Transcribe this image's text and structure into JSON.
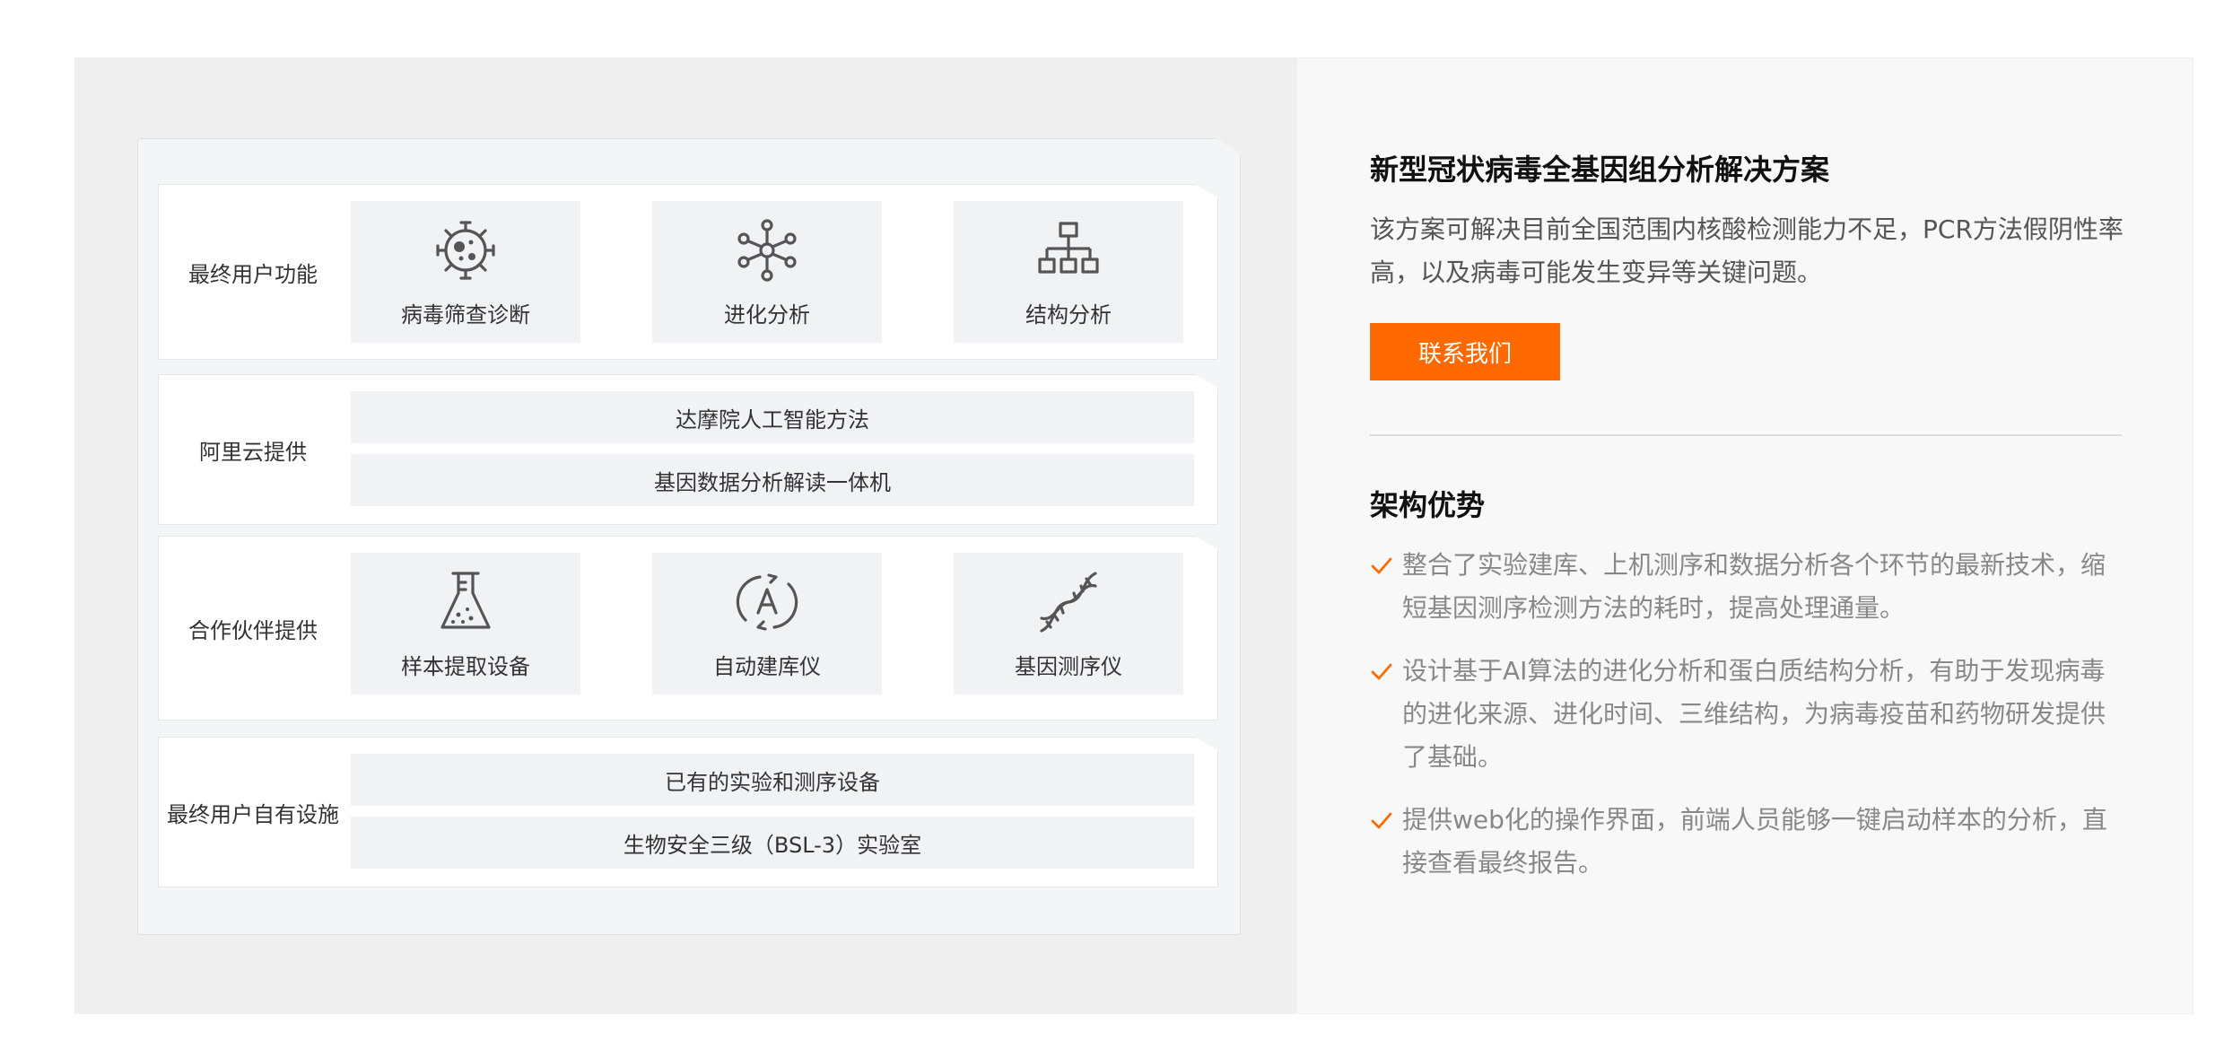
{
  "diagram": {
    "rows": [
      {
        "label": "最终用户功能",
        "tiles": [
          {
            "label": "病毒筛查诊断",
            "icon": "virus-icon"
          },
          {
            "label": "进化分析",
            "icon": "molecule-network-icon"
          },
          {
            "label": "结构分析",
            "icon": "hierarchy-icon"
          }
        ]
      },
      {
        "label": "阿里云提供",
        "bars": [
          "达摩院人工智能方法",
          "基因数据分析解读一体机"
        ]
      },
      {
        "label": "合作伙伴提供",
        "tiles": [
          {
            "label": "样本提取设备",
            "icon": "flask-icon"
          },
          {
            "label": "自动建库仪",
            "icon": "auto-cycle-icon"
          },
          {
            "label": "基因测序仪",
            "icon": "dna-icon"
          }
        ]
      },
      {
        "label": "最终用户自有设施",
        "bars": [
          "已有的实验和测序设备",
          "生物安全三级（BSL-3）实验室"
        ]
      }
    ]
  },
  "solution": {
    "title": "新型冠状病毒全基因组分析解决方案",
    "description": "该方案可解决目前全国范围内核酸检测能力不足，PCR方法假阴性率高，以及病毒可能发生变异等关键问题。",
    "contact_label": "联系我们"
  },
  "advantages": {
    "title": "架构优势",
    "items": [
      "整合了实验建库、上机测序和数据分析各个环节的最新技术，缩短基因测序检测方法的耗时，提高处理通量。",
      "设计基于AI算法的进化分析和蛋白质结构分析，有助于发现病毒的进化来源、进化时间、三维结构，为病毒疫苗和药物研发提供了基础。",
      "提供web化的操作界面，前端人员能够一键启动样本的分析，直接查看最终报告。"
    ]
  },
  "colors": {
    "accent": "#ff6a00",
    "left_panel_bg": "#efefef",
    "right_panel_bg": "#f8f8f8",
    "tile_bg": "#f0f2f3"
  }
}
